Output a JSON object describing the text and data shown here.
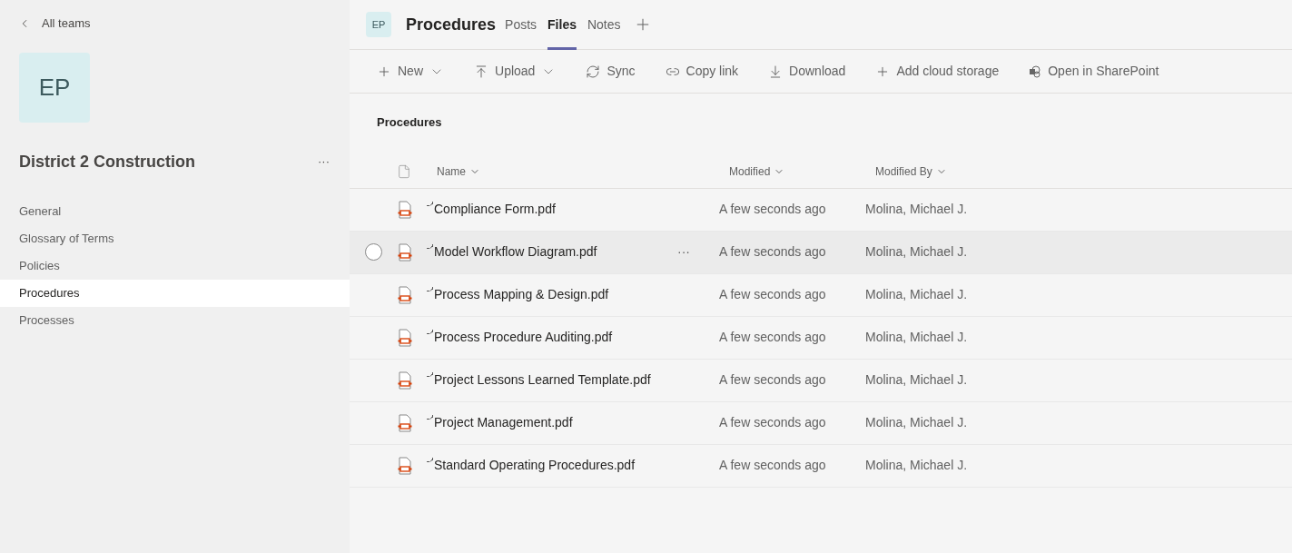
{
  "sidebar": {
    "back": "All teams",
    "team_avatar": "EP",
    "team_name": "District 2 Construction",
    "more": "···",
    "channels": [
      {
        "label": "General",
        "selected": false
      },
      {
        "label": "Glossary of Terms",
        "selected": false
      },
      {
        "label": "Policies",
        "selected": false
      },
      {
        "label": "Procedures",
        "selected": true
      },
      {
        "label": "Processes",
        "selected": false
      }
    ]
  },
  "header": {
    "avatar": "EP",
    "title": "Procedures",
    "tabs": [
      {
        "label": "Posts",
        "selected": false
      },
      {
        "label": "Files",
        "selected": true
      },
      {
        "label": "Notes",
        "selected": false
      }
    ]
  },
  "toolbar": [
    {
      "kind": "plus",
      "label": "New",
      "dropdown": true
    },
    {
      "kind": "upload",
      "label": "Upload",
      "dropdown": true
    },
    {
      "kind": "sync",
      "label": "Sync",
      "dropdown": false
    },
    {
      "kind": "link",
      "label": "Copy link",
      "dropdown": false
    },
    {
      "kind": "download",
      "label": "Download",
      "dropdown": false
    },
    {
      "kind": "plus",
      "label": "Add cloud storage",
      "dropdown": false
    },
    {
      "kind": "sharepoint",
      "label": "Open in SharePoint",
      "dropdown": false
    }
  ],
  "breadcrumb": "Procedures",
  "table": {
    "columns": [
      "Name",
      "Modified",
      "Modified By"
    ],
    "more": "···",
    "rows": [
      {
        "name": "Compliance Form.pdf",
        "modified": "A few seconds ago",
        "modified_by": "Molina, Michael J.",
        "hovered": false
      },
      {
        "name": "Model Workflow Diagram.pdf",
        "modified": "A few seconds ago",
        "modified_by": "Molina, Michael J.",
        "hovered": true
      },
      {
        "name": "Process Mapping & Design.pdf",
        "modified": "A few seconds ago",
        "modified_by": "Molina, Michael J.",
        "hovered": false
      },
      {
        "name": "Process Procedure Auditing.pdf",
        "modified": "A few seconds ago",
        "modified_by": "Molina, Michael J.",
        "hovered": false
      },
      {
        "name": "Project Lessons Learned Template.pdf",
        "modified": "A few seconds ago",
        "modified_by": "Molina, Michael J.",
        "hovered": false
      },
      {
        "name": "Project Management.pdf",
        "modified": "A few seconds ago",
        "modified_by": "Molina, Michael J.",
        "hovered": false
      },
      {
        "name": "Standard Operating Procedures.pdf",
        "modified": "A few seconds ago",
        "modified_by": "Molina, Michael J.",
        "hovered": false
      }
    ]
  }
}
